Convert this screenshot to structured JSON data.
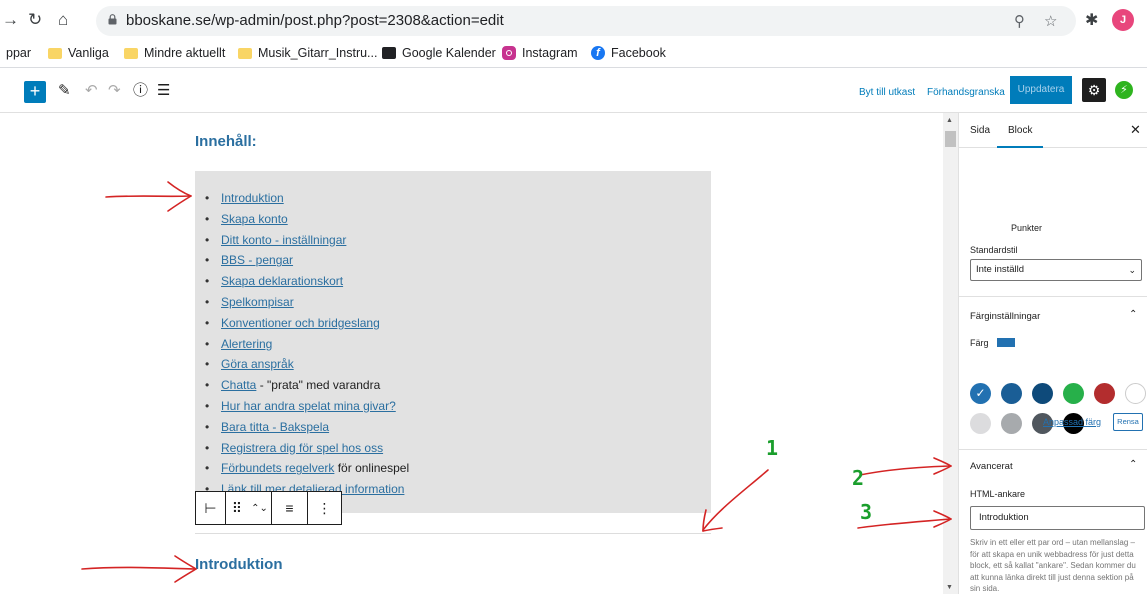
{
  "browser": {
    "url": "bboskane.se/wp-admin/post.php?post=2308&action=edit",
    "profile_initial": "J",
    "bookmarks": [
      "ppar",
      "Vanliga",
      "Mindre aktuellt",
      "Musik_Gitarr_Instru...",
      "Google Kalender",
      "Instagram",
      "Facebook"
    ]
  },
  "toolbar": {
    "switch_draft": "Byt till utkast",
    "preview": "Förhandsgranska",
    "update": "Uppdatera"
  },
  "content": {
    "toc_heading": "Innehåll:",
    "toc_items": [
      {
        "link": "Introduktion",
        "rest": ""
      },
      {
        "link": "Skapa konto",
        "rest": ""
      },
      {
        "link": "Ditt konto - inställningar",
        "rest": ""
      },
      {
        "link": "BBS - pengar",
        "rest": ""
      },
      {
        "link": "Skapa deklarationskort",
        "rest": ""
      },
      {
        "link": "Spelkompisar",
        "rest": ""
      },
      {
        "link": "Konventioner och bridgeslang",
        "rest": ""
      },
      {
        "link": "Alertering",
        "rest": ""
      },
      {
        "link": "Göra anspråk",
        "rest": ""
      },
      {
        "link": "Chatta",
        "rest": " - \"prata\" med varandra"
      },
      {
        "link": "Hur har andra spelat mina givar?",
        "rest": ""
      },
      {
        "link": "Bara titta - Bakspela",
        "rest": ""
      },
      {
        "link": "Registrera dig för spel hos oss",
        "rest": ""
      },
      {
        "link": "Förbundets regelverk",
        "rest": " för onlinespel"
      },
      {
        "link": "Länk till mer detaljerad information",
        "rest": ""
      }
    ],
    "intro_heading": "Introduktion"
  },
  "sidebar": {
    "tab_page": "Sida",
    "tab_block": "Block",
    "style_label": "Punkter",
    "default_style_label": "Standardstil",
    "default_style_value": "Inte inställd",
    "color_settings_title": "Färginställningar",
    "color_label": "Färg",
    "colors": [
      "#2271b1",
      "#1a5e96",
      "#0e4a7a",
      "#27b04a",
      "#b32d2e",
      "#ffffff",
      "#dcdcde",
      "#a7aaad",
      "#50575e",
      "#000000"
    ],
    "custom_color": "Anpassad färg",
    "clear": "Rensa",
    "advanced_title": "Avancerat",
    "html_anchor_label": "HTML-ankare",
    "html_anchor_value": "Introduktion",
    "help_text": "Skriv in ett eller ett par ord – utan mellanslag – för att skapa en unik webbadress för just detta block, ett så kallat \"ankare\". Sedan kommer du att kunna länka direkt till just denna sektion på sin sida."
  },
  "annotations": {
    "numbers": [
      "1",
      "2",
      "3"
    ]
  }
}
